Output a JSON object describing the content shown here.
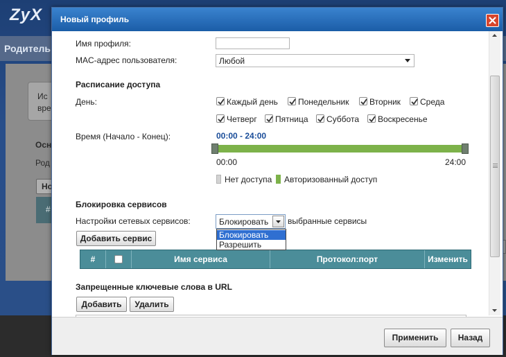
{
  "background": {
    "logo": "ZyX",
    "section": "Родитель",
    "info_line1": "Ис",
    "info_line2": "вре",
    "heading": "Осн",
    "row": "Род",
    "button": "Но",
    "table_hash": "#"
  },
  "modal": {
    "title": "Новый профиль",
    "profile_name_label": "Имя профиля:",
    "profile_name_value": "",
    "mac_label": "MAC-адрес пользователя:",
    "mac_value": "Любой",
    "schedule_heading": "Расписание доступа",
    "day_label": "День:",
    "days": [
      {
        "label": "Каждый день",
        "checked": true
      },
      {
        "label": "Понедельник",
        "checked": true
      },
      {
        "label": "Вторник",
        "checked": true
      },
      {
        "label": "Среда",
        "checked": true
      },
      {
        "label": "Четверг",
        "checked": true
      },
      {
        "label": "Пятница",
        "checked": true
      },
      {
        "label": "Суббота",
        "checked": true
      },
      {
        "label": "Воскресенье",
        "checked": true
      }
    ],
    "time_label": "Время (Начало - Конец):",
    "time_range": "00:00 - 24:00",
    "time_start": "00:00",
    "time_end": "24:00",
    "legend_no_access": "Нет доступа",
    "legend_authorized": "Авторизованный доступ",
    "block_heading": "Блокировка сервисов",
    "net_services_label": "Настройки сетевых сервисов:",
    "service_mode_value": "Блокировать",
    "service_mode_suffix": "выбранные сервисы",
    "service_mode_options": [
      "Блокировать",
      "Разрешить"
    ],
    "add_service_button": "Добавить сервис",
    "table_headers": [
      "#",
      "",
      "Имя сервиса",
      "Протокол:порт",
      "Изменить"
    ],
    "url_heading": "Запрещенные ключевые слова в URL",
    "add_button": "Добавить",
    "delete_button": "Удалить",
    "apply_button": "Применить",
    "back_button": "Назад"
  },
  "colors": {
    "title_bar": "#1b5da7",
    "allowed": "#7db24a",
    "denied": "#d3d3d3",
    "table_header": "#4b8d99",
    "dropdown_highlight": "#2f6fd1",
    "close": "#d8452c"
  }
}
